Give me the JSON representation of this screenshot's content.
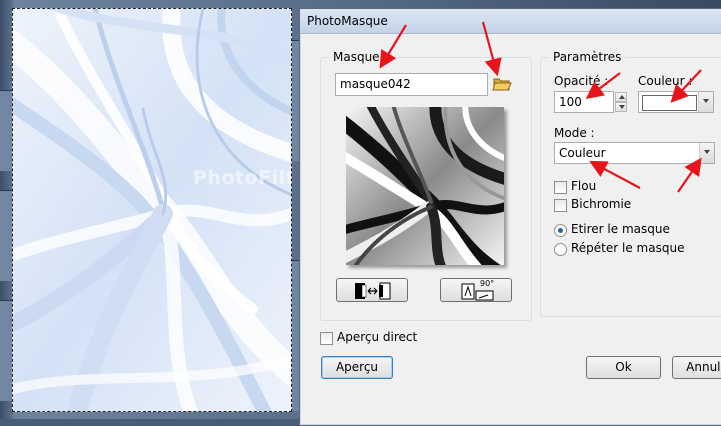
{
  "window_title": "PhotoMasque",
  "watermark": "PhotoFiltreGraph",
  "mask_group": {
    "legend": "Masque",
    "file_value": "masque042",
    "invert_icon": "swap-mask-icon",
    "rotate_icon": "rotate-90-icon",
    "rotate_text": "90°"
  },
  "params_group": {
    "legend": "Paramètres",
    "opacity_label": "Opacité :",
    "opacity_value": "100",
    "color_label": "Couleur :",
    "color_value": "#ffffff",
    "mode_label": "Mode :",
    "mode_value": "Couleur",
    "flou_label": "Flou",
    "flou_checked": false,
    "bichromie_label": "Bichromie",
    "bichromie_checked": false,
    "radio_stretch_label": "Etirer le masque",
    "radio_repeat_label": "Répéter le masque",
    "selected_radio": "stretch"
  },
  "live_preview_label": "Aperçu direct",
  "live_preview_checked": false,
  "buttons": {
    "preview": "Aperçu",
    "ok": "Ok",
    "cancel": "Annuler"
  },
  "colors": {
    "annotation_arrow": "#e8141b",
    "accent": "#3c7fb1",
    "canvas_tint": "#dfe9f7"
  }
}
